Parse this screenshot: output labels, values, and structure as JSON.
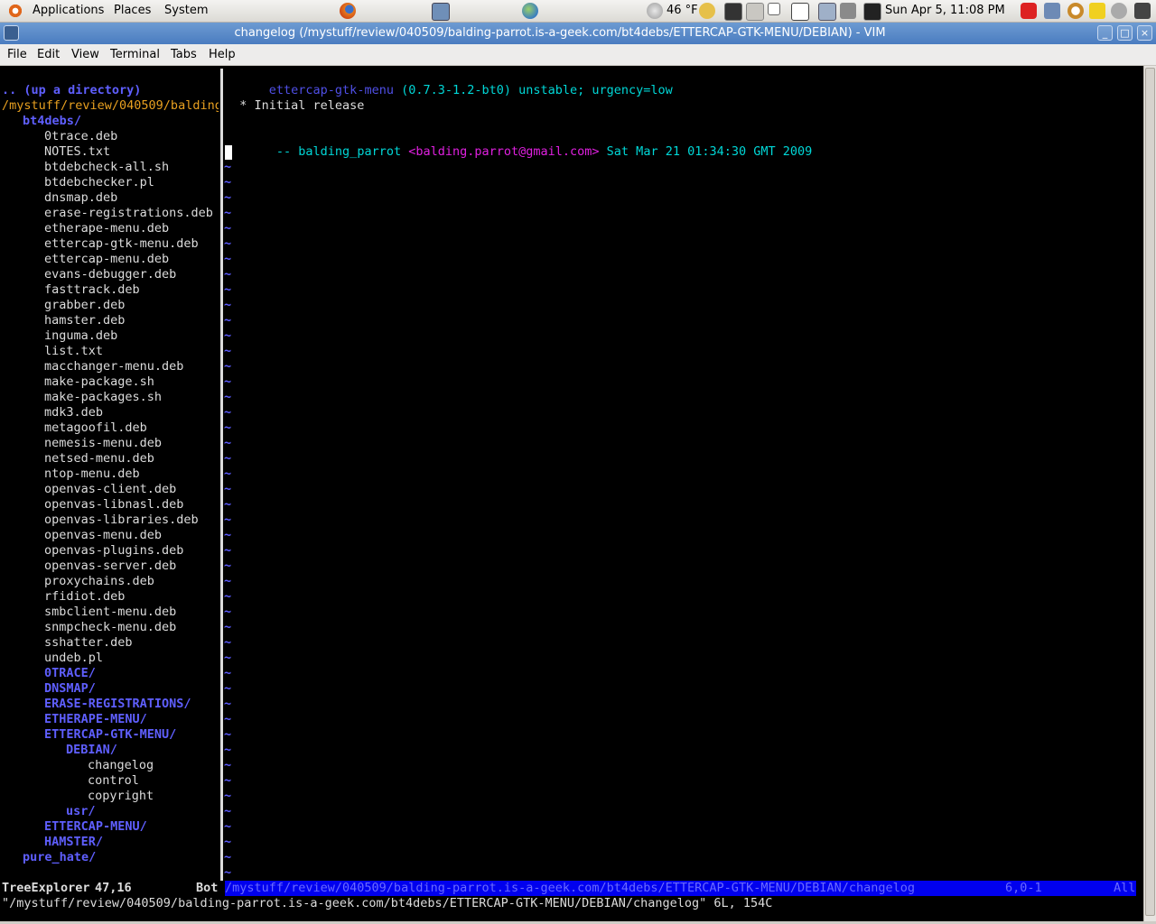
{
  "panel": {
    "menus": [
      "Applications",
      "Places",
      "System"
    ],
    "weather": "46 °F",
    "clock": "Sun Apr  5, 11:08 PM",
    "icons": [
      "ubuntu-logo-icon",
      "firefox-icon",
      "network-icon",
      "globe-icon",
      "weather-icon",
      "terminal-launcher-icon",
      "firefox-task-icon",
      "window-task-icon",
      "window-task-icon-2",
      "printer-icon",
      "volume-icon",
      "terminal-icon",
      "download-icon",
      "network-status-icon",
      "search-icon",
      "note-icon",
      "settings-icon",
      "shutdown-icon"
    ]
  },
  "window": {
    "title": "changelog (/mystuff/review/040509/balding-parrot.is-a-geek.com/bt4debs/ETTERCAP-GTK-MENU/DEBIAN) - VIM",
    "minimize": "_",
    "maximize": "□",
    "close": "×"
  },
  "menubar": [
    "File",
    "Edit",
    "View",
    "Terminal",
    "Tabs",
    "Help"
  ],
  "tree": {
    "up": ".. (up a directory)",
    "root": "/mystuff/review/040509/balding",
    "items": [
      {
        "text": "bt4debs/",
        "indent": 1,
        "dir": true
      },
      {
        "text": "0trace.deb",
        "indent": 2,
        "dir": false
      },
      {
        "text": "NOTES.txt",
        "indent": 2,
        "dir": false
      },
      {
        "text": "btdebcheck-all.sh",
        "indent": 2,
        "dir": false
      },
      {
        "text": "btdebchecker.pl",
        "indent": 2,
        "dir": false
      },
      {
        "text": "dnsmap.deb",
        "indent": 2,
        "dir": false
      },
      {
        "text": "erase-registrations.deb",
        "indent": 2,
        "dir": false
      },
      {
        "text": "etherape-menu.deb",
        "indent": 2,
        "dir": false
      },
      {
        "text": "ettercap-gtk-menu.deb",
        "indent": 2,
        "dir": false
      },
      {
        "text": "ettercap-menu.deb",
        "indent": 2,
        "dir": false
      },
      {
        "text": "evans-debugger.deb",
        "indent": 2,
        "dir": false
      },
      {
        "text": "fasttrack.deb",
        "indent": 2,
        "dir": false
      },
      {
        "text": "grabber.deb",
        "indent": 2,
        "dir": false
      },
      {
        "text": "hamster.deb",
        "indent": 2,
        "dir": false
      },
      {
        "text": "inguma.deb",
        "indent": 2,
        "dir": false
      },
      {
        "text": "list.txt",
        "indent": 2,
        "dir": false
      },
      {
        "text": "macchanger-menu.deb",
        "indent": 2,
        "dir": false
      },
      {
        "text": "make-package.sh",
        "indent": 2,
        "dir": false
      },
      {
        "text": "make-packages.sh",
        "indent": 2,
        "dir": false
      },
      {
        "text": "mdk3.deb",
        "indent": 2,
        "dir": false
      },
      {
        "text": "metagoofil.deb",
        "indent": 2,
        "dir": false
      },
      {
        "text": "nemesis-menu.deb",
        "indent": 2,
        "dir": false
      },
      {
        "text": "netsed-menu.deb",
        "indent": 2,
        "dir": false
      },
      {
        "text": "ntop-menu.deb",
        "indent": 2,
        "dir": false
      },
      {
        "text": "openvas-client.deb",
        "indent": 2,
        "dir": false
      },
      {
        "text": "openvas-libnasl.deb",
        "indent": 2,
        "dir": false
      },
      {
        "text": "openvas-libraries.deb",
        "indent": 2,
        "dir": false
      },
      {
        "text": "openvas-menu.deb",
        "indent": 2,
        "dir": false
      },
      {
        "text": "openvas-plugins.deb",
        "indent": 2,
        "dir": false
      },
      {
        "text": "openvas-server.deb",
        "indent": 2,
        "dir": false
      },
      {
        "text": "proxychains.deb",
        "indent": 2,
        "dir": false
      },
      {
        "text": "rfidiot.deb",
        "indent": 2,
        "dir": false
      },
      {
        "text": "smbclient-menu.deb",
        "indent": 2,
        "dir": false
      },
      {
        "text": "snmpcheck-menu.deb",
        "indent": 2,
        "dir": false
      },
      {
        "text": "sshatter.deb",
        "indent": 2,
        "dir": false
      },
      {
        "text": "undeb.pl",
        "indent": 2,
        "dir": false
      },
      {
        "text": "0TRACE/",
        "indent": 2,
        "dir": true
      },
      {
        "text": "DNSMAP/",
        "indent": 2,
        "dir": true
      },
      {
        "text": "ERASE-REGISTRATIONS/",
        "indent": 2,
        "dir": true
      },
      {
        "text": "ETHERAPE-MENU/",
        "indent": 2,
        "dir": true
      },
      {
        "text": "ETTERCAP-GTK-MENU/",
        "indent": 2,
        "dir": true
      },
      {
        "text": "DEBIAN/",
        "indent": 3,
        "dir": true
      },
      {
        "text": "changelog",
        "indent": 4,
        "dir": false
      },
      {
        "text": "control",
        "indent": 4,
        "dir": false
      },
      {
        "text": "copyright",
        "indent": 4,
        "dir": false
      },
      {
        "text": "usr/",
        "indent": 3,
        "dir": true
      },
      {
        "text": "ETTERCAP-MENU/",
        "indent": 2,
        "dir": true
      },
      {
        "text": "HAMSTER/",
        "indent": 2,
        "dir": true
      },
      {
        "text": "pure_hate/",
        "indent": 1,
        "dir": true
      }
    ]
  },
  "editor": {
    "line1_pkg": "ettercap-gtk-menu",
    "line1_ver": " (0.7.3-1.2-bt0) unstable; urgency=low",
    "line3": "  * Initial release",
    "line5_prefix": " -- balding_parrot ",
    "line5_email": "<balding.parrot@gmail.com>",
    "line5_date": " Sat Mar 21 01:34:30 GMT 2009",
    "tilde": "~"
  },
  "statusline": {
    "left_name": "TreeExplorer",
    "left_pos": "47,16",
    "left_scroll": "Bot",
    "right_path": "/mystuff/review/040509/balding-parrot.is-a-geek.com/bt4debs/ETTERCAP-GTK-MENU/DEBIAN/changelog",
    "right_pos": "6,0-1",
    "right_scroll": "All"
  },
  "cmdline": "\"/mystuff/review/040509/balding-parrot.is-a-geek.com/bt4debs/ETTERCAP-GTK-MENU/DEBIAN/changelog\" 6L, 154C"
}
